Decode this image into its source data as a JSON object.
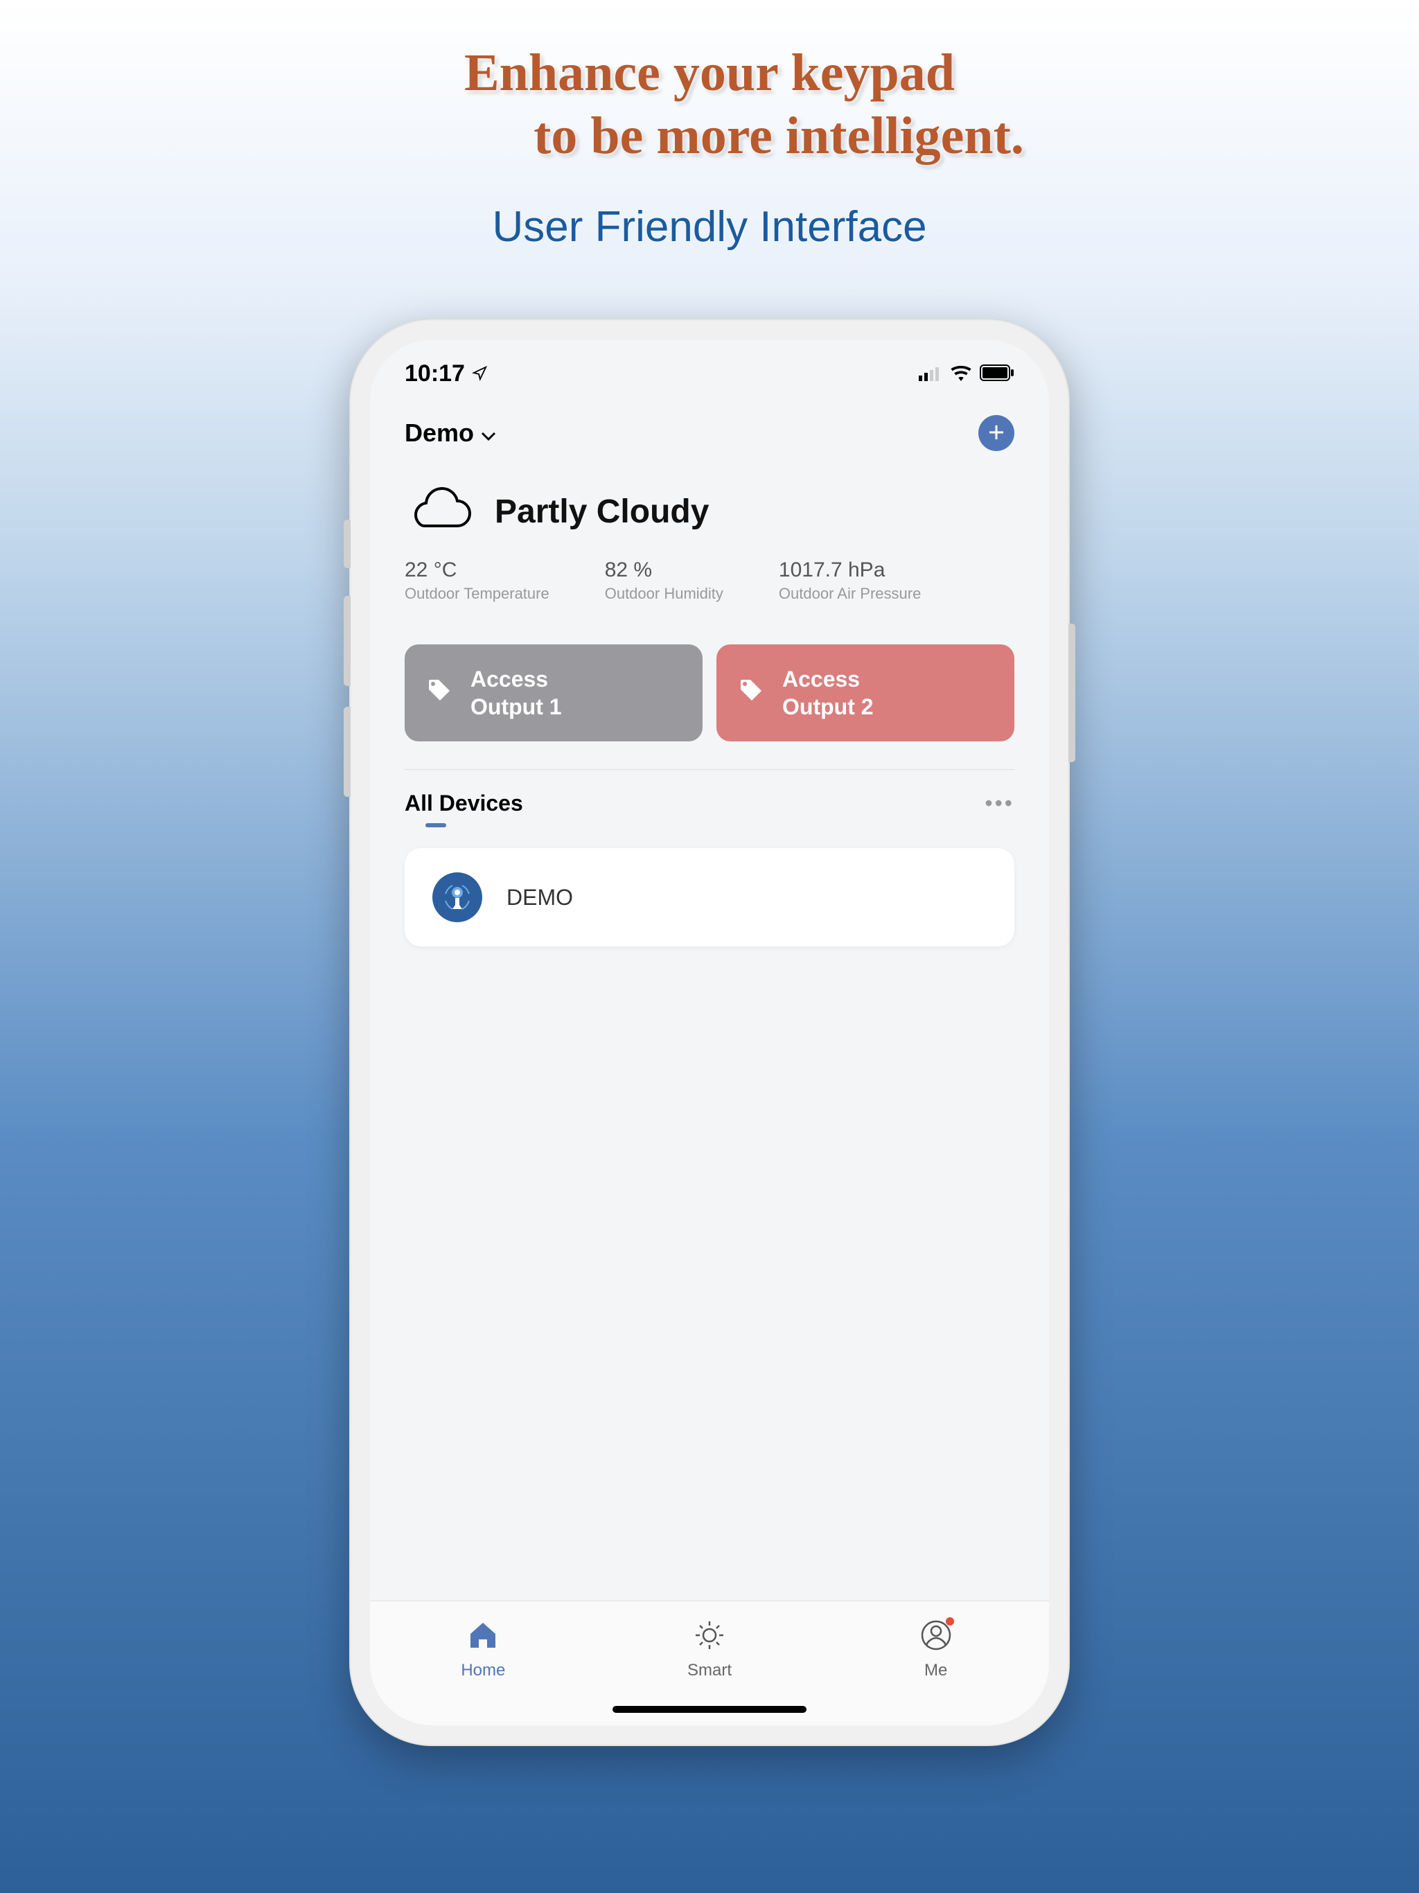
{
  "marketing": {
    "headline_line1": "Enhance your keypad",
    "headline_line2": "to be more intelligent.",
    "subheadline": "User Friendly Interface"
  },
  "status_bar": {
    "time": "10:17"
  },
  "header": {
    "location": "Demo"
  },
  "weather": {
    "condition": "Partly Cloudy",
    "stats": [
      {
        "value": "22 °C",
        "label": "Outdoor Temperature"
      },
      {
        "value": "82 %",
        "label": "Outdoor Humidity"
      },
      {
        "value": "1017.7 hPa",
        "label": "Outdoor Air Pressure"
      }
    ]
  },
  "access": [
    {
      "label_line1": "Access",
      "label_line2": "Output 1"
    },
    {
      "label_line1": "Access",
      "label_line2": "Output 2"
    }
  ],
  "devices": {
    "section_title": "All Devices",
    "items": [
      {
        "name": "DEMO"
      }
    ]
  },
  "nav": [
    {
      "label": "Home"
    },
    {
      "label": "Smart"
    },
    {
      "label": "Me"
    }
  ]
}
